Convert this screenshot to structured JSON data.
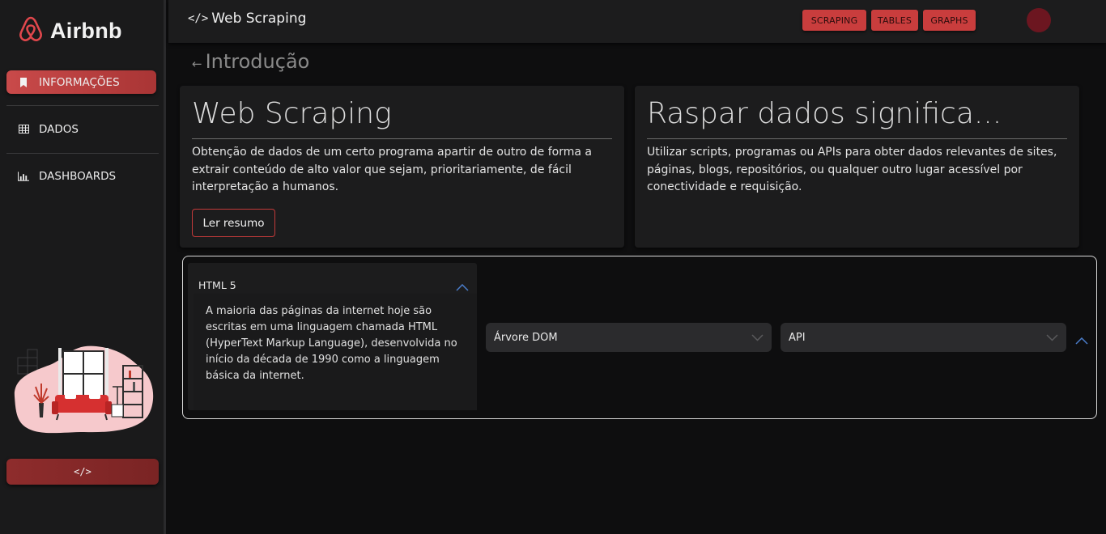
{
  "sidebar": {
    "brand": "Airbnb",
    "items": [
      {
        "label": "INFORMAÇÕES",
        "icon": "bookmark-icon"
      },
      {
        "label": "DADOS",
        "icon": "table-icon"
      },
      {
        "label": "DASHBOARDS",
        "icon": "bar-chart-icon"
      }
    ],
    "footer_button": "</>"
  },
  "topbar": {
    "code_glyph": "</>",
    "title": "Web Scraping",
    "tabs": [
      "SCRAPING",
      "TABLES",
      "GRAPHS"
    ]
  },
  "breadcrumb": {
    "arrow": "←",
    "label": "Introdução"
  },
  "cards": [
    {
      "title": "Web Scraping",
      "text": "Obtenção de dados de um certo programa apartir de outro de forma a extrair conteúdo de alto valor que sejam, prioritariamente, de fácil interpretação a humanos.",
      "button": "Ler resumo"
    },
    {
      "title": "Raspar dados significa...",
      "text": "Utilizar scripts, programas ou APIs para obter dados relevantes de sites, páginas, blogs, repositórios, ou qualquer outro lugar acessível por conectividade e requisição."
    }
  ],
  "accordion": {
    "html": {
      "title": "HTML 5",
      "text": "A maioria das páginas da internet hoje são escritas em uma linguagem chamada HTML (HyperText Markup Language), desenvolvida no início da década de 1990 como a linguagem básica da internet."
    },
    "dom": {
      "title": "Árvore DOM"
    },
    "api": {
      "title": "API"
    }
  },
  "colors": {
    "accent": "#c93d3d",
    "background": "#0e0e0f",
    "surface": "#1c1c1d",
    "avatar": "#6c1620"
  }
}
